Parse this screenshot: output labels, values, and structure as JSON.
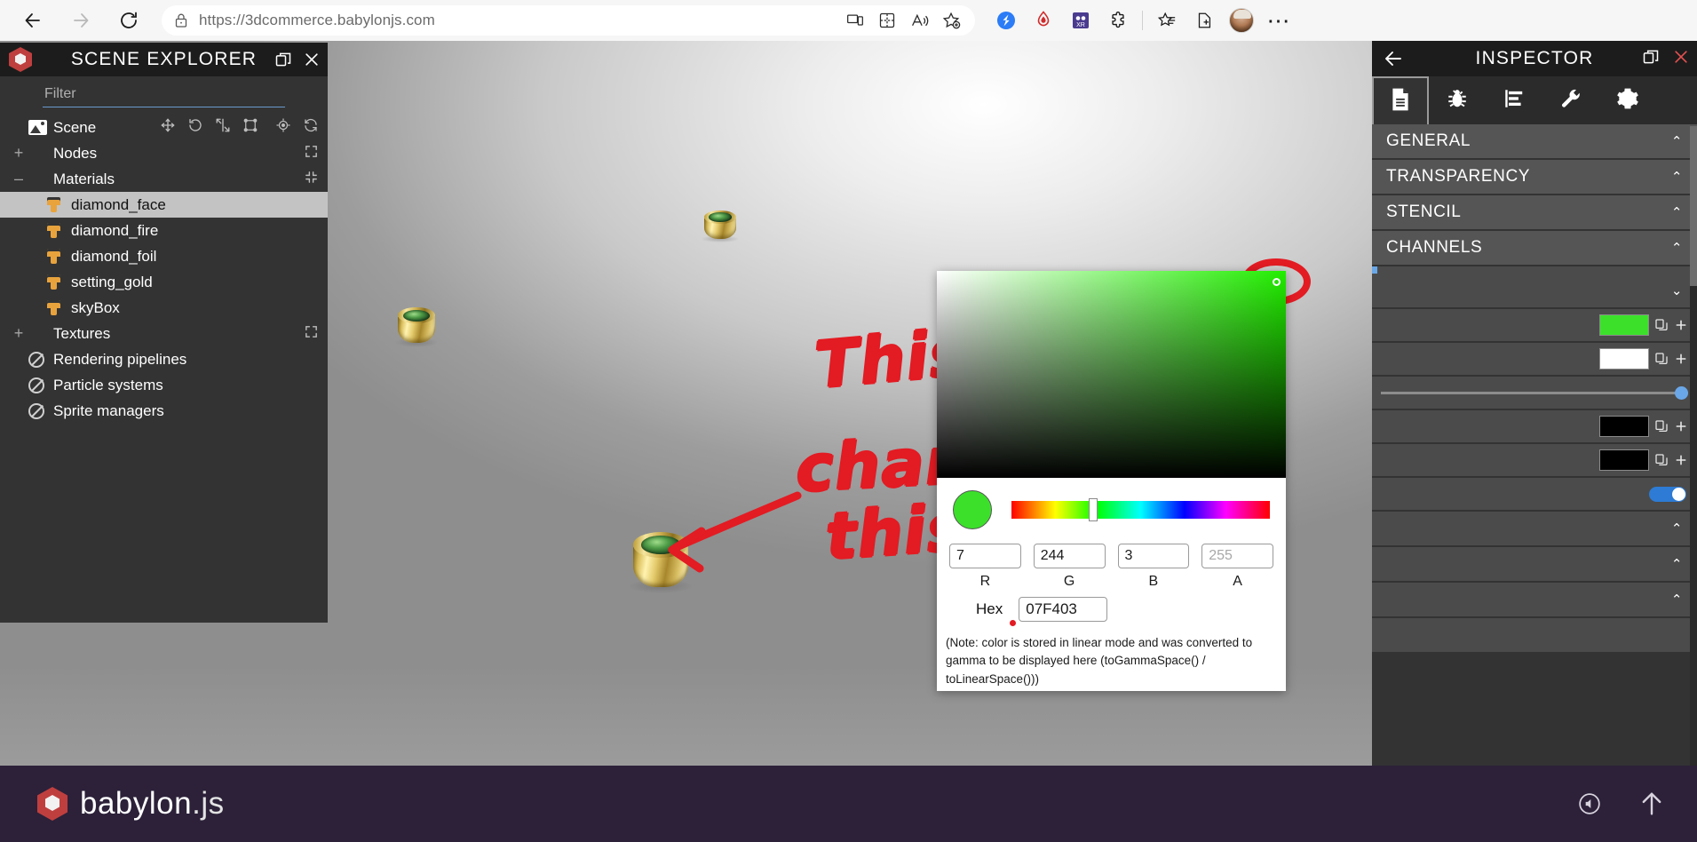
{
  "browser": {
    "url": "https://3dcommerce.babylonjs.com",
    "back_label": "Back",
    "forward_label": "Forward",
    "reload_label": "Refresh",
    "icons": {
      "lock": "lock-icon",
      "cast": "device-cast-icon",
      "split": "split-screen-icon",
      "read_aloud": "read-aloud-icon",
      "favorite": "add-favorite-icon",
      "ext_blue": "extension-blue-icon",
      "ext_red": "extension-red-icon",
      "ext_xr": "extension-xr-icon",
      "extensions": "extensions-puzzle-icon",
      "collections": "collections-icon",
      "split_screen": "browser-essentials-icon",
      "profile": "profile-avatar",
      "settings_more": "settings-and-more-icon"
    }
  },
  "scene_explorer": {
    "title": "SCENE EXPLORER",
    "logo": "babylon-hex-logo",
    "popout_label": "pop-out-icon",
    "close_label": "close-icon",
    "filter_placeholder": "Filter",
    "filter_value": "",
    "tree": [
      {
        "label": "Scene",
        "expander": "",
        "icon": "scene-image-icon",
        "indent": 0,
        "selected": false,
        "tools": [
          "move-gizmo-icon",
          "rotate-gizmo-icon",
          "scale-gizmo-icon",
          "bounding-box-icon",
          "target-icon",
          "refresh-icon"
        ]
      },
      {
        "label": "Nodes",
        "expander": "+",
        "icon": "",
        "indent": 0,
        "selected": false,
        "tools": [
          "expand-all-icon"
        ]
      },
      {
        "label": "Materials",
        "expander": "–",
        "icon": "",
        "indent": 0,
        "selected": false,
        "tools": [
          "collapse-all-icon"
        ]
      },
      {
        "label": "diamond_face",
        "expander": "",
        "icon": "material-brush-icon",
        "indent": 1,
        "selected": true,
        "tools": []
      },
      {
        "label": "diamond_fire",
        "expander": "",
        "icon": "material-brush-icon",
        "indent": 1,
        "selected": false,
        "tools": []
      },
      {
        "label": "diamond_foil",
        "expander": "",
        "icon": "material-brush-icon",
        "indent": 1,
        "selected": false,
        "tools": []
      },
      {
        "label": "setting_gold",
        "expander": "",
        "icon": "material-brush-icon",
        "indent": 1,
        "selected": false,
        "tools": []
      },
      {
        "label": "skyBox",
        "expander": "",
        "icon": "material-brush-icon",
        "indent": 1,
        "selected": false,
        "tools": []
      },
      {
        "label": "Textures",
        "expander": "+",
        "icon": "",
        "indent": 0,
        "selected": false,
        "tools": [
          "expand-all-icon"
        ]
      },
      {
        "label": "Rendering pipelines",
        "expander": "",
        "icon": "no-entry-icon",
        "indent": 0,
        "selected": false,
        "tools": []
      },
      {
        "label": "Particle systems",
        "expander": "",
        "icon": "no-entry-icon",
        "indent": 0,
        "selected": false,
        "tools": []
      },
      {
        "label": "Sprite managers",
        "expander": "",
        "icon": "no-entry-icon",
        "indent": 0,
        "selected": false,
        "tools": []
      }
    ]
  },
  "inspector": {
    "title": "INSPECTOR",
    "back_label": "back-arrow-icon",
    "popout_label": "pop-out-icon",
    "close_label": "close-icon",
    "tabs": [
      {
        "name": "properties",
        "icon": "document-properties-icon",
        "active": true
      },
      {
        "name": "debug",
        "icon": "bug-debug-icon",
        "active": false
      },
      {
        "name": "statistics",
        "icon": "statistics-bars-icon",
        "active": false
      },
      {
        "name": "tools",
        "icon": "wrench-tools-icon",
        "active": false
      },
      {
        "name": "settings",
        "icon": "gear-settings-icon",
        "active": false
      }
    ],
    "sections": [
      {
        "label": "GENERAL",
        "chevron": "⌃"
      },
      {
        "label": "TRANSPARENCY",
        "chevron": "⌃"
      },
      {
        "label": "STENCIL",
        "chevron": "⌃"
      },
      {
        "label": "CHANNELS",
        "chevron": "⌃"
      }
    ],
    "collapsed_section_chevron": "⌄",
    "swatches": [
      {
        "name": "albedo-color-swatch",
        "color": "#3ce02b",
        "copy": "copy-icon",
        "add": "add-icon"
      },
      {
        "name": "reflectivity-color-swatch",
        "color": "#ffffff",
        "copy": "copy-icon",
        "add": "add-icon"
      },
      {
        "name": "ambient-color-swatch",
        "color": "#000000",
        "copy": "copy-icon",
        "add": "add-icon"
      },
      {
        "name": "emissive-color-swatch",
        "color": "#000000",
        "copy": "copy-icon",
        "add": "add-icon"
      }
    ],
    "toggle_on": true,
    "bottom_chevrons": [
      "⌃",
      "⌃",
      "⌃"
    ]
  },
  "color_picker": {
    "preview_color": "#3ce02b",
    "sv_base_color": "#22ee00",
    "cursor_name": "saturation-value-cursor",
    "hue_position_pct": 30,
    "fields": [
      {
        "name": "red-input",
        "value": "7",
        "caption": "R",
        "disabled": false
      },
      {
        "name": "green-input",
        "value": "244",
        "caption": "G",
        "disabled": false
      },
      {
        "name": "blue-input",
        "value": "3",
        "caption": "B",
        "disabled": false
      },
      {
        "name": "alpha-input",
        "value": "255",
        "caption": "A",
        "disabled": true
      }
    ],
    "hex_label": "Hex",
    "hex_value": "07F403",
    "note": "(Note: color is stored in linear mode and was converted to gamma to be displayed here (toGammaSpace() / toLinearSpace()))"
  },
  "annotations": {
    "line1": "This",
    "line2": "changes",
    "line3": "this",
    "color": "#e31b23"
  },
  "footer": {
    "brand": "babylon",
    "brand_suffix": ".js",
    "logo": "babylon-hex-logo",
    "mute_icon": "sound-icon",
    "upload_icon": "upload-arrow-icon"
  }
}
